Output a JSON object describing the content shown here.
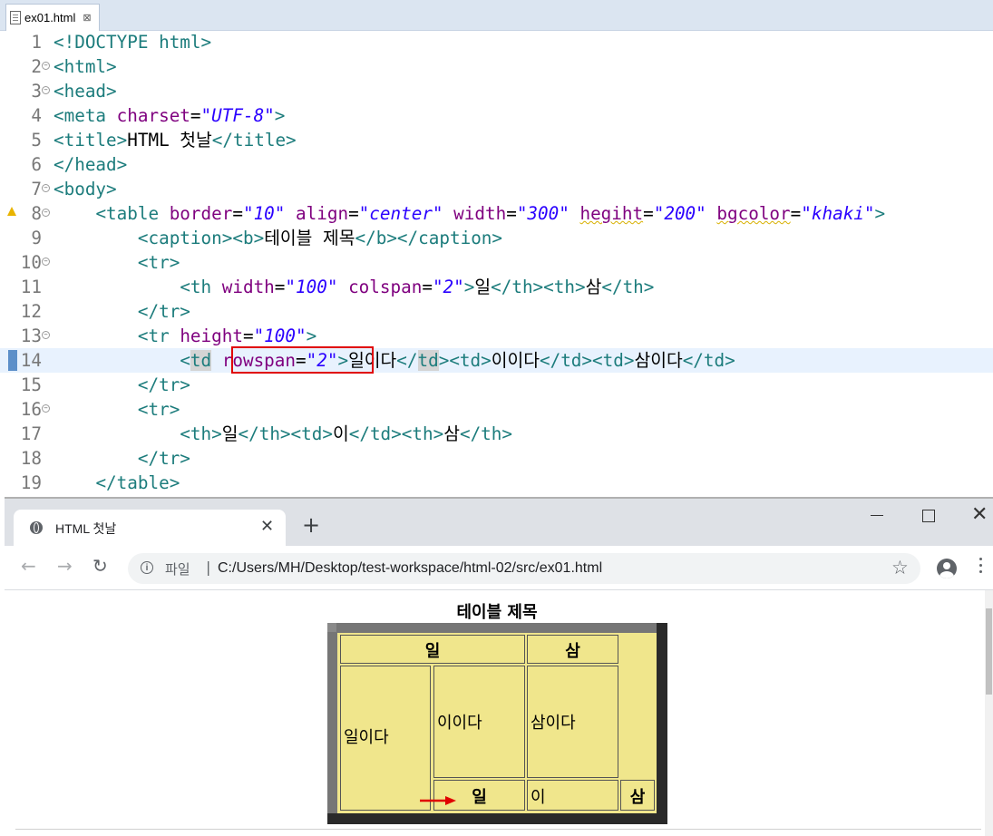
{
  "editor": {
    "file_tab": "ex01.html",
    "tab_close": "⊠",
    "lines": [
      {
        "n": "1",
        "parts": [
          [
            "t",
            "<!DOCTYPE html>"
          ]
        ]
      },
      {
        "n": "2",
        "fold": true,
        "parts": [
          [
            "t",
            "<html>"
          ]
        ]
      },
      {
        "n": "3",
        "fold": true,
        "parts": [
          [
            "t",
            "<head>"
          ]
        ]
      },
      {
        "n": "4",
        "parts": [
          [
            "t",
            "<meta "
          ],
          [
            "a",
            "charset"
          ],
          [
            "x",
            "="
          ],
          [
            "v",
            "\"UTF-8\""
          ],
          [
            "t",
            ">"
          ]
        ]
      },
      {
        "n": "5",
        "parts": [
          [
            "t",
            "<title>"
          ],
          [
            "x",
            "HTML 첫날"
          ],
          [
            "t",
            "</title>"
          ]
        ]
      },
      {
        "n": "6",
        "parts": [
          [
            "t",
            "</head>"
          ]
        ]
      },
      {
        "n": "7",
        "fold": true,
        "parts": [
          [
            "t",
            "<body>"
          ]
        ]
      },
      {
        "n": "8",
        "fold": true,
        "warn": true,
        "parts": [
          [
            "x",
            "    "
          ],
          [
            "t",
            "<table "
          ],
          [
            "a",
            "border"
          ],
          [
            "x",
            "="
          ],
          [
            "v",
            "\"10\""
          ],
          [
            "x",
            " "
          ],
          [
            "a",
            "align"
          ],
          [
            "x",
            "="
          ],
          [
            "v",
            "\"center\""
          ],
          [
            "x",
            " "
          ],
          [
            "a",
            "width"
          ],
          [
            "x",
            "="
          ],
          [
            "v",
            "\"300\""
          ],
          [
            "x",
            " "
          ],
          [
            "as",
            "hegiht"
          ],
          [
            "x",
            "="
          ],
          [
            "v",
            "\"200\""
          ],
          [
            "x",
            " "
          ],
          [
            "as",
            "bgcolor"
          ],
          [
            "x",
            "="
          ],
          [
            "v",
            "\"khaki\""
          ],
          [
            "t",
            ">"
          ]
        ]
      },
      {
        "n": "9",
        "parts": [
          [
            "x",
            "        "
          ],
          [
            "t",
            "<caption><b>"
          ],
          [
            "x",
            "테이블 제목"
          ],
          [
            "t",
            "</b></caption>"
          ]
        ]
      },
      {
        "n": "10",
        "fold": true,
        "parts": [
          [
            "x",
            "        "
          ],
          [
            "t",
            "<tr>"
          ]
        ]
      },
      {
        "n": "11",
        "parts": [
          [
            "x",
            "            "
          ],
          [
            "t",
            "<th "
          ],
          [
            "a",
            "width"
          ],
          [
            "x",
            "="
          ],
          [
            "v",
            "\"100\""
          ],
          [
            "x",
            " "
          ],
          [
            "a",
            "colspan"
          ],
          [
            "x",
            "="
          ],
          [
            "v",
            "\"2\""
          ],
          [
            "t",
            ">"
          ],
          [
            "x",
            "일"
          ],
          [
            "t",
            "</th><th>"
          ],
          [
            "x",
            "삼"
          ],
          [
            "t",
            "</th>"
          ]
        ]
      },
      {
        "n": "12",
        "parts": [
          [
            "x",
            "        "
          ],
          [
            "t",
            "</tr>"
          ]
        ]
      },
      {
        "n": "13",
        "fold": true,
        "parts": [
          [
            "x",
            "        "
          ],
          [
            "t",
            "<tr "
          ],
          [
            "a",
            "height"
          ],
          [
            "x",
            "="
          ],
          [
            "v",
            "\"100\""
          ],
          [
            "t",
            ">"
          ]
        ]
      },
      {
        "n": "14",
        "hl": true,
        "cursor": true,
        "parts": [
          [
            "x",
            "            "
          ],
          [
            "t",
            "<"
          ],
          [
            "tg",
            "td"
          ],
          [
            "x",
            " "
          ],
          [
            "a",
            "rowspan"
          ],
          [
            "x",
            "="
          ],
          [
            "v",
            "\"2\""
          ],
          [
            "t",
            ">"
          ],
          [
            "x",
            "일이다"
          ],
          [
            "t",
            "</"
          ],
          [
            "tg",
            "td"
          ],
          [
            "t",
            "><td>"
          ],
          [
            "x",
            "이이다"
          ],
          [
            "t",
            "</td><td>"
          ],
          [
            "x",
            "삼이다"
          ],
          [
            "t",
            "</td>"
          ]
        ]
      },
      {
        "n": "15",
        "parts": [
          [
            "x",
            "        "
          ],
          [
            "t",
            "</tr>"
          ]
        ]
      },
      {
        "n": "16",
        "fold": true,
        "parts": [
          [
            "x",
            "        "
          ],
          [
            "t",
            "<tr>"
          ]
        ]
      },
      {
        "n": "17",
        "parts": [
          [
            "x",
            "            "
          ],
          [
            "t",
            "<th>"
          ],
          [
            "x",
            "일"
          ],
          [
            "t",
            "</th><td>"
          ],
          [
            "x",
            "이"
          ],
          [
            "t",
            "</td><th>"
          ],
          [
            "x",
            "삼"
          ],
          [
            "t",
            "</th>"
          ]
        ]
      },
      {
        "n": "18",
        "parts": [
          [
            "x",
            "        "
          ],
          [
            "t",
            "</tr>"
          ]
        ]
      },
      {
        "n": "19",
        "parts": [
          [
            "x",
            "    "
          ],
          [
            "t",
            "</table>"
          ]
        ]
      }
    ]
  },
  "browser": {
    "tab_title": "HTML 첫날",
    "tab_close": "✕",
    "new_tab": "+",
    "window_close": "✕",
    "nav": {
      "back": "←",
      "forward": "→",
      "reload": "↻"
    },
    "url_scheme": "파일",
    "url_sep": "|",
    "url": "C:/Users/MH/Desktop/test-workspace/html-02/src/ex01.html",
    "star": "☆",
    "info": "i"
  },
  "page": {
    "caption": "테이블 제목",
    "table": {
      "r1c1": "일",
      "r1c2": "삼",
      "r2_rowspan": "일이다",
      "r2c2": "이이다",
      "r2c3": "삼이다",
      "r3c1": "일",
      "r3c2": "이",
      "r3c3": "삼"
    }
  },
  "colors": {
    "khaki": "#f0e68c",
    "tag": "#1c7c7c",
    "attr": "#7f007f",
    "value": "#2a00ff",
    "annotation": "#e00000"
  }
}
